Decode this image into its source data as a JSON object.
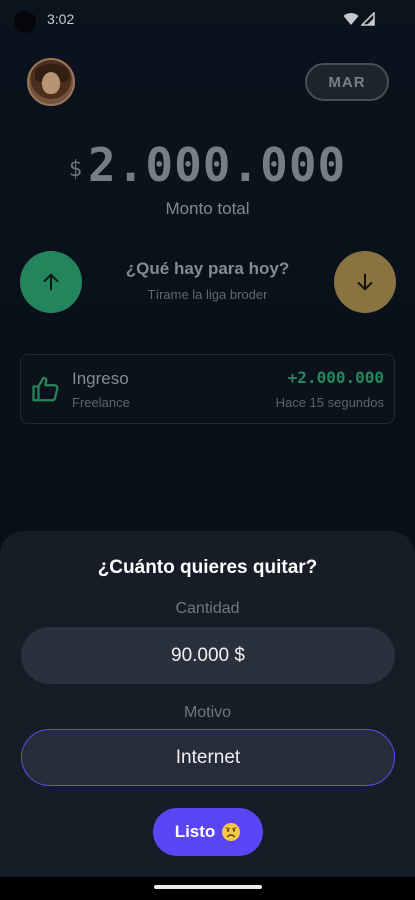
{
  "status_bar": {
    "time": "3:02"
  },
  "header": {
    "month": "MAR"
  },
  "balance": {
    "currency": "$",
    "amount": "2.000.000",
    "label": "Monto total"
  },
  "prompt": {
    "title": "¿Qué hay para hoy?",
    "subtitle": "Tírame la liga broder"
  },
  "transactions": [
    {
      "name": "Ingreso",
      "category": "Freelance",
      "amount": "+2.000.000",
      "time": "Hace 15 segundos"
    }
  ],
  "sheet": {
    "title": "¿Cuánto quieres quitar?",
    "quantity_label": "Cantidad",
    "quantity_value": "90.000 $",
    "reason_label": "Motivo",
    "reason_value": "Internet",
    "done_label": "Listo"
  },
  "colors": {
    "income": "#2b9c6d",
    "expense": "#a0874c",
    "accent": "#5a45f5",
    "background": "#0b111a"
  },
  "icons": [
    "wifi-icon",
    "signal-icon",
    "arrow-up-icon",
    "arrow-down-icon",
    "thumbs-up-icon",
    "worried-face-emoji"
  ]
}
